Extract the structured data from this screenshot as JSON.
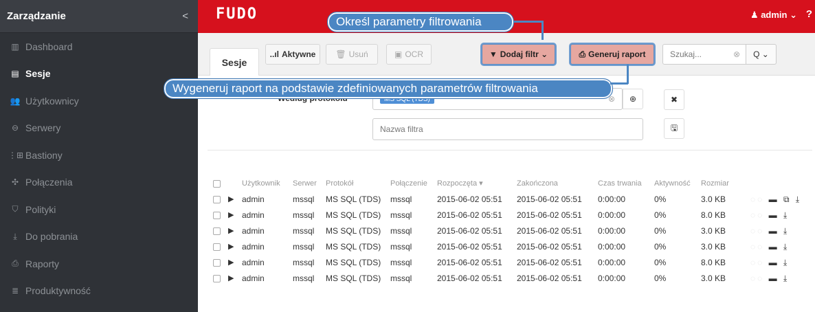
{
  "sidebar": {
    "title": "Zarządzanie",
    "collapse_glyph": "<",
    "items": [
      {
        "label": "Dashboard",
        "icon": "▥"
      },
      {
        "label": "Sesje",
        "icon": "▤"
      },
      {
        "label": "Użytkownicy",
        "icon": "👥"
      },
      {
        "label": "Serwery",
        "icon": "⊖"
      },
      {
        "label": "Bastiony",
        "icon": "⋮⊞"
      },
      {
        "label": "Połączenia",
        "icon": "✣"
      },
      {
        "label": "Polityki",
        "icon": "⛉"
      },
      {
        "label": "Do pobrania",
        "icon": "⤓"
      },
      {
        "label": "Raporty",
        "icon": "⎙"
      },
      {
        "label": "Produktywność",
        "icon": "≣"
      }
    ]
  },
  "topbar": {
    "logo": "FUDO",
    "user": "♟ admin ⌄",
    "help": "?"
  },
  "toolbar": {
    "tab": "Sesje",
    "active": "Aktywne",
    "active_icon": "..ıl",
    "delete": "Usuń",
    "delete_icon": "🗑",
    "ocr": "OCR",
    "ocr_icon": "▣",
    "add_filter": "Dodaj filtr ⌄",
    "add_filter_icon": "▼",
    "report": "Generuj raport",
    "report_icon": "⎙",
    "search_placeholder": "Szukaj...",
    "search_clear": "⊗",
    "search_btn": "Q ⌄"
  },
  "filter": {
    "protocol_label": "Według protokołu",
    "protocol_tag": "MS SQL (TDS)",
    "name_placeholder": "Nazwa filtra",
    "zoom": "⊕",
    "remove": "✖",
    "save": "🖫",
    "clear": "⊗"
  },
  "callouts": {
    "filter_params": "Określ parametry filtrowania",
    "generate_report": "Wygeneruj raport na podstawie zdefiniowanych parametrów filtrowania"
  },
  "table": {
    "headers": [
      "Użytkownik",
      "Serwer",
      "Protokół",
      "Połączenie",
      "Rozpoczęta ▾",
      "Zakończona",
      "Czas trwania",
      "Aktywność",
      "Rozmiar"
    ],
    "rows": [
      {
        "user": "admin",
        "server": "mssql",
        "protocol": "MS SQL (TDS)",
        "conn": "mssql",
        "start": "2015-06-02 05:51",
        "end": "2015-06-02 05:51",
        "duration": "0:00:00",
        "activity": "0%",
        "size": "3.0 KB",
        "acts": "▬ ⧉ ⤓"
      },
      {
        "user": "admin",
        "server": "mssql",
        "protocol": "MS SQL (TDS)",
        "conn": "mssql",
        "start": "2015-06-02 05:51",
        "end": "2015-06-02 05:51",
        "duration": "0:00:00",
        "activity": "0%",
        "size": "8.0 KB",
        "acts": "▬ ⤓"
      },
      {
        "user": "admin",
        "server": "mssql",
        "protocol": "MS SQL (TDS)",
        "conn": "mssql",
        "start": "2015-06-02 05:51",
        "end": "2015-06-02 05:51",
        "duration": "0:00:00",
        "activity": "0%",
        "size": "3.0 KB",
        "acts": "▬ ⤓"
      },
      {
        "user": "admin",
        "server": "mssql",
        "protocol": "MS SQL (TDS)",
        "conn": "mssql",
        "start": "2015-06-02 05:51",
        "end": "2015-06-02 05:51",
        "duration": "0:00:00",
        "activity": "0%",
        "size": "3.0 KB",
        "acts": "▬ ⤓"
      },
      {
        "user": "admin",
        "server": "mssql",
        "protocol": "MS SQL (TDS)",
        "conn": "mssql",
        "start": "2015-06-02 05:51",
        "end": "2015-06-02 05:51",
        "duration": "0:00:00",
        "activity": "0%",
        "size": "8.0 KB",
        "acts": "▬ ⤓"
      },
      {
        "user": "admin",
        "server": "mssql",
        "protocol": "MS SQL (TDS)",
        "conn": "mssql",
        "start": "2015-06-02 05:51",
        "end": "2015-06-02 05:51",
        "duration": "0:00:00",
        "activity": "0%",
        "size": "3.0 KB",
        "acts": "▬ ⤓"
      }
    ]
  },
  "colors": {
    "brand_red": "#d6111d",
    "sidebar_bg": "#2f3237",
    "callout_blue": "#4b86c3",
    "highlight_fill": "#e6a7a0"
  }
}
